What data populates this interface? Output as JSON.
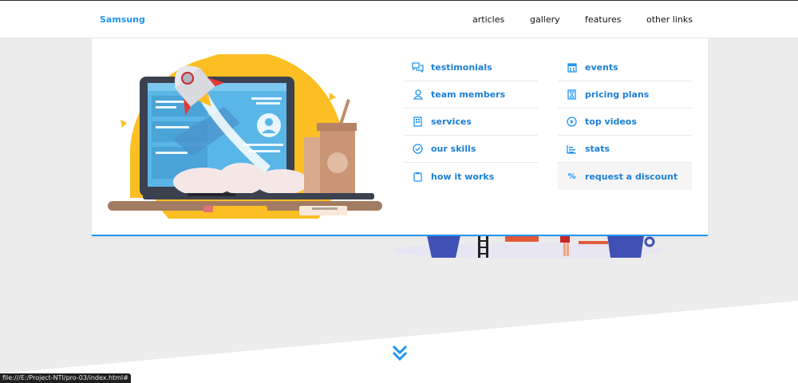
{
  "brand": {
    "name": "Samsung"
  },
  "nav": [
    {
      "label": "articles"
    },
    {
      "label": "gallery"
    },
    {
      "label": "features"
    },
    {
      "label": "other links"
    }
  ],
  "mega_menu": {
    "column_1": [
      {
        "label": "testimonials",
        "icon": "chat-bubbles-icon"
      },
      {
        "label": "team members",
        "icon": "user-icon"
      },
      {
        "label": "services",
        "icon": "building-icon"
      },
      {
        "label": "our skills",
        "icon": "check-circle-icon"
      },
      {
        "label": "how it works",
        "icon": "clipboard-icon"
      }
    ],
    "column_2": [
      {
        "label": "events",
        "icon": "calendar-icon"
      },
      {
        "label": "pricing plans",
        "icon": "hourglass-icon"
      },
      {
        "label": "top videos",
        "icon": "play-circle-icon"
      },
      {
        "label": "stats",
        "icon": "bar-chart-icon"
      },
      {
        "label": "request a discount",
        "icon": "percent-icon",
        "percent_glyph": "%"
      }
    ]
  },
  "status_bar": {
    "url": "file:///E:/Project-NTI/pro-03/index.html#"
  },
  "colors": {
    "accent": "#2196f3",
    "link": "#1c7fd6",
    "page_bg": "#ececec",
    "illustration_yellow": "#fbbf24"
  }
}
